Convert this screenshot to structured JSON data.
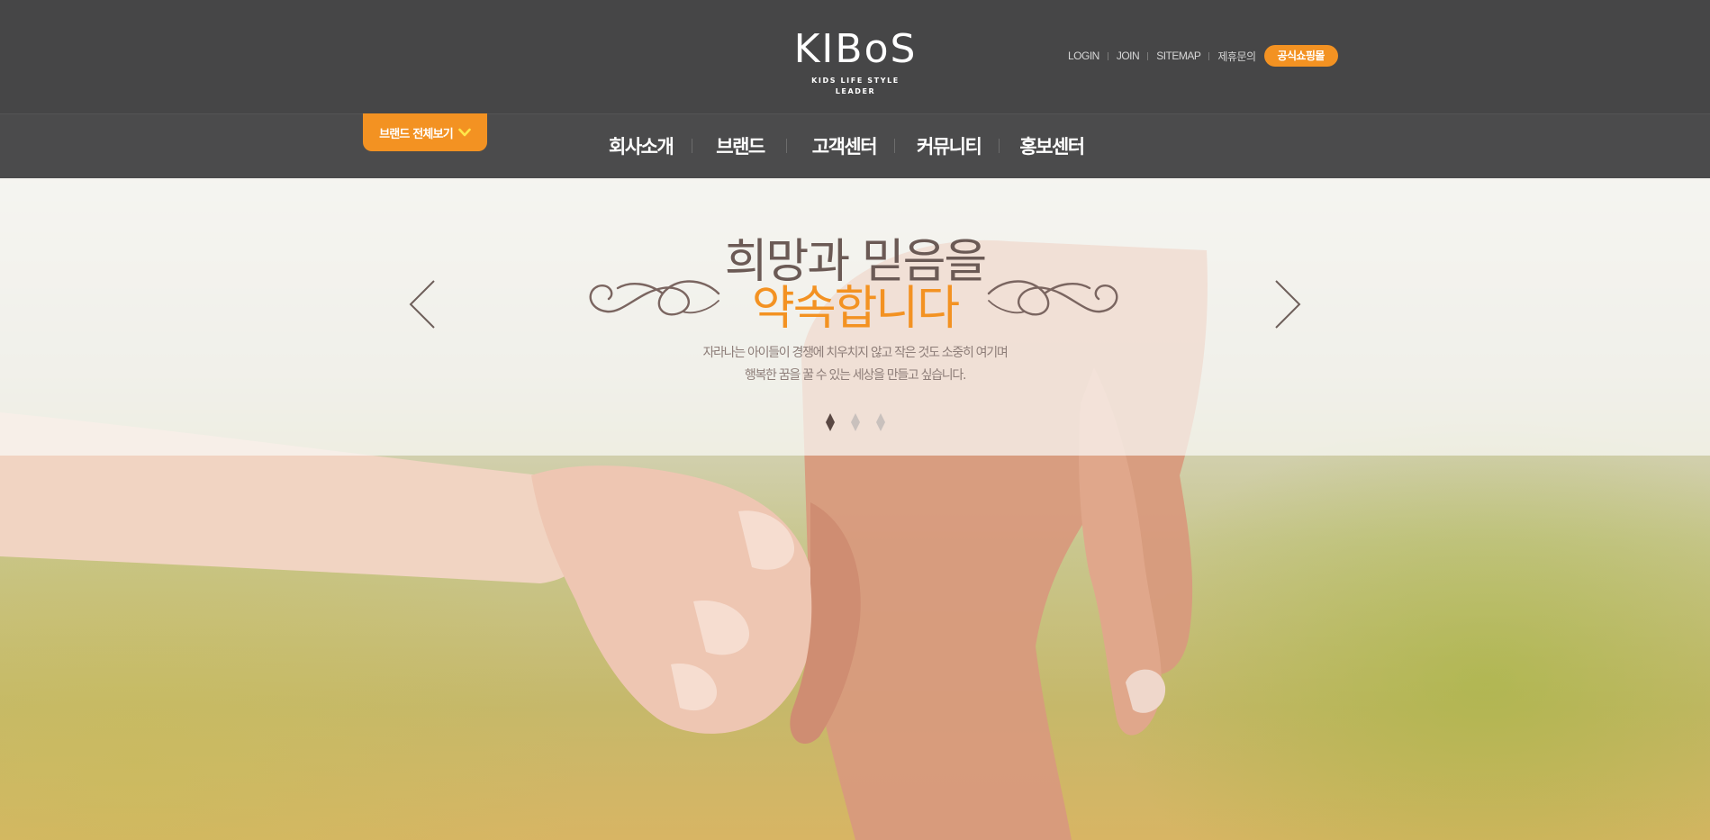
{
  "header": {
    "logo_text": "KIBoS",
    "logo_tagline": "KIDS LIFE STYLE LEADER",
    "util_links": [
      "LOGIN",
      "JOIN",
      "SITEMAP",
      "제휴문의"
    ],
    "shop_button": "공식쇼핑몰"
  },
  "nav": {
    "brand_all_button": "브랜드 전체보기",
    "menu": [
      "회사소개",
      "브랜드",
      "고객센터",
      "커뮤니티",
      "홍보센터"
    ]
  },
  "hero": {
    "headline_line1": "희망과 믿음을",
    "headline_line2": "약속합니다",
    "subtitle_line1": "자라나는 아이들이 경쟁에 치우치지 않고 작은 것도 소중히 여기며",
    "subtitle_line2": "행복한 꿈을 꿀 수 있는 세상을 만들고 싶습니다.",
    "slide_count": 3,
    "active_slide": 1
  },
  "colors": {
    "accent": "#f39222",
    "header_bg": "#464647",
    "nav_bg": "#4b4b4c",
    "headline_brown": "#6b5a55",
    "chevron_yellow": "#ffe74a"
  },
  "icons": {
    "brand_toggle": "chevron-down-icon",
    "prev": "chevron-left-icon",
    "next": "chevron-right-icon",
    "flourish": "ornament-flourish-icon",
    "indicator": "diamond-icon"
  }
}
